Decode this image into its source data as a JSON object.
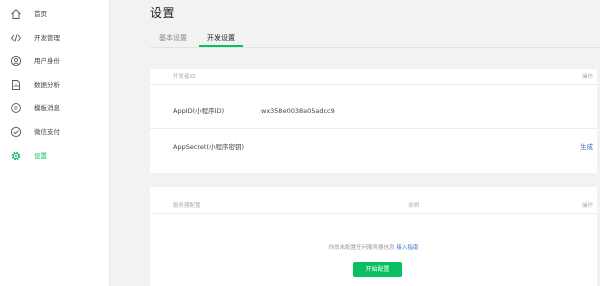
{
  "sidebar": {
    "items": [
      {
        "label": "首页",
        "icon": "home-icon",
        "active": false
      },
      {
        "label": "开发管理",
        "icon": "code-icon",
        "active": false
      },
      {
        "label": "用户身份",
        "icon": "user-icon",
        "active": false
      },
      {
        "label": "数据分析",
        "icon": "document-chart-icon",
        "active": false
      },
      {
        "label": "模板消息",
        "icon": "message-icon",
        "active": false
      },
      {
        "label": "微信支付",
        "icon": "payment-icon",
        "active": false
      },
      {
        "label": "设置",
        "icon": "gear-icon",
        "active": true
      }
    ]
  },
  "header": {
    "title": "设置"
  },
  "tabs": [
    {
      "label": "基本设置",
      "active": false
    },
    {
      "label": "开发设置",
      "active": true
    }
  ],
  "developer_panel": {
    "header": {
      "title": "开发者ID",
      "action": "操作"
    },
    "rows": [
      {
        "label": "AppID(小程序ID)",
        "value": "wx358e0038a05adcc9",
        "action": ""
      },
      {
        "label": "AppSecret(小程序密钥)",
        "value": "",
        "action": "生成"
      }
    ]
  },
  "server_panel": {
    "header": {
      "title": "服务器配置",
      "desc": "说明",
      "action": "操作"
    },
    "empty_text": "你尚未配置任何服务器信息",
    "guide_link": "接入指南",
    "enable_button": "开始配置"
  },
  "colors": {
    "accent": "#07c160",
    "link": "#3a72c2",
    "background": "#f2f2f2"
  }
}
